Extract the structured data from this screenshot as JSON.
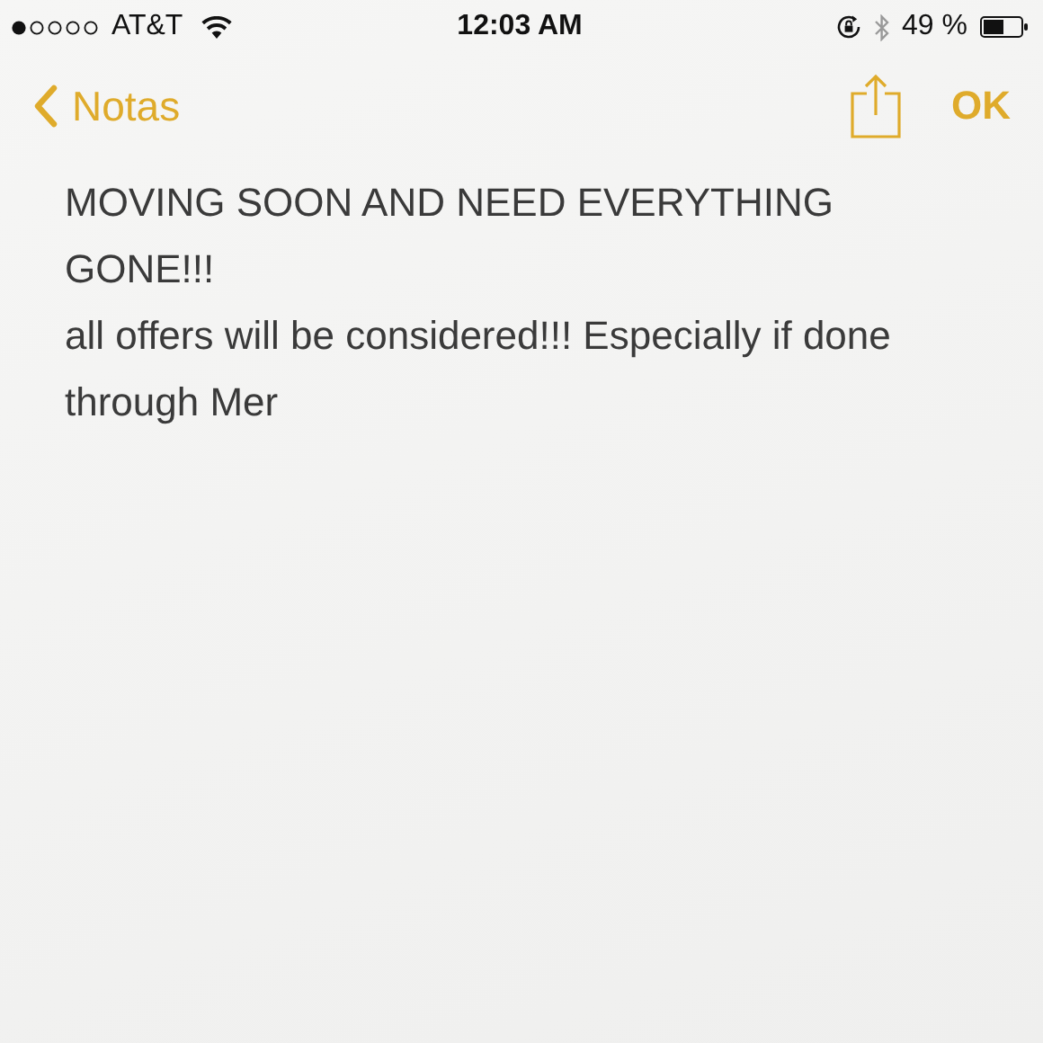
{
  "status_bar": {
    "carrier": "AT&T",
    "time": "12:03 AM",
    "battery": "49 %"
  },
  "nav_bar": {
    "back": "Notas",
    "done": "OK"
  },
  "note": {
    "paragraphs": [
      "MOVING SOON AND NEED EVERYTHING GONE!!!",
      "all offers will be considered!!! Especially if done through Mer"
    ]
  }
}
